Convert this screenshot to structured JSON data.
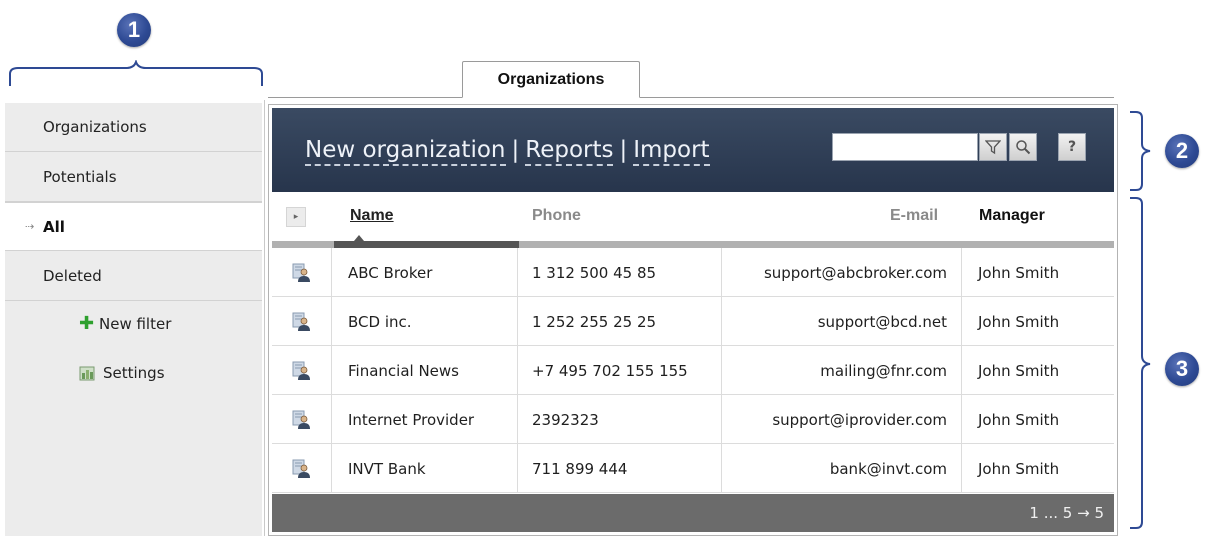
{
  "callouts": [
    "1",
    "2",
    "3"
  ],
  "tab": {
    "label": "Organizations"
  },
  "sidebar": {
    "items": [
      {
        "label": "Organizations"
      },
      {
        "label": "Potentials"
      },
      {
        "label": "All",
        "active": true
      },
      {
        "label": "Deleted"
      }
    ],
    "new_filter": "New filter",
    "settings": "Settings"
  },
  "header": {
    "links": [
      "New organization",
      "Reports",
      "Import"
    ],
    "search_value": "",
    "buttons": [
      "filter-icon",
      "search-icon",
      "help-icon"
    ],
    "help_label": "?"
  },
  "table": {
    "expand_glyph": "▸",
    "columns": [
      "Name",
      "Phone",
      "E-mail",
      "Manager"
    ],
    "rows": [
      {
        "name": "ABC Broker",
        "phone": "1 312 500 45 85",
        "email": "support@abcbroker.com",
        "manager": "John Smith"
      },
      {
        "name": "BCD inc.",
        "phone": "1 252 255 25 25",
        "email": "support@bcd.net",
        "manager": "John Smith"
      },
      {
        "name": "Financial News",
        "phone": "+7 495 702 155 155",
        "email": "mailing@fnr.com",
        "manager": "John Smith"
      },
      {
        "name": "Internet Provider",
        "phone": "2392323",
        "email": "support@iprovider.com",
        "manager": "John Smith"
      },
      {
        "name": "INVT Bank",
        "phone": "711 899 444",
        "email": "bank@invt.com",
        "manager": "John Smith"
      }
    ]
  },
  "pagination": "1 ... 5 → 5",
  "colors": {
    "header_bg": "#2f3d55",
    "callout": "#2e4a94",
    "footer_bg": "#6b6b6b",
    "sidebar_bg": "#ececec"
  }
}
